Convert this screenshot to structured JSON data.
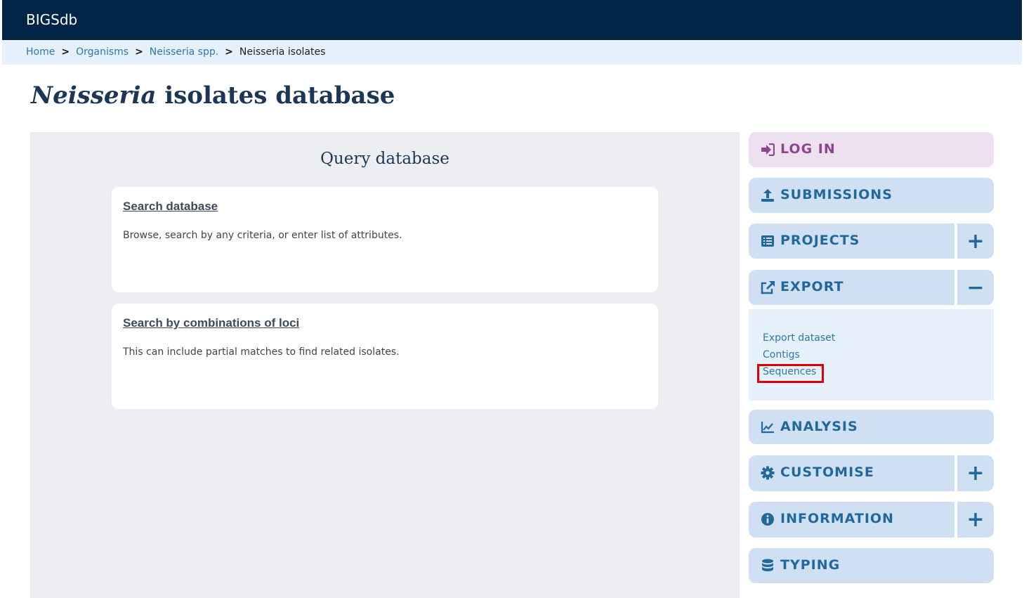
{
  "header": {
    "brand": "BIGSdb"
  },
  "breadcrumb": {
    "items": [
      "Home",
      "Organisms",
      "Neisseria spp."
    ],
    "separator": ">",
    "current": "Neisseria isolates"
  },
  "page_title": {
    "italic": "Neisseria",
    "rest": " isolates database"
  },
  "query": {
    "title": "Query database",
    "cards": [
      {
        "link": "Search database",
        "description": "Browse, search by any criteria, or enter list of attributes."
      },
      {
        "link": "Search by combinations of loci",
        "description": "This can include partial matches to find related isolates."
      }
    ]
  },
  "sidebar": {
    "login": "LOG IN",
    "submissions": "SUBMISSIONS",
    "projects": "PROJECTS",
    "export": "EXPORT",
    "analysis": "ANALYSIS",
    "customise": "CUSTOMISE",
    "information": "INFORMATION",
    "typing": "TYPING",
    "expand_symbol": "+",
    "collapse_symbol": "−",
    "export_items": [
      "Export dataset",
      "Contigs",
      "Sequences"
    ]
  },
  "colors": {
    "header_bg": "#022547",
    "breadcrumb_bg": "#e7f1fc",
    "menu_bg": "#cfe0f3",
    "login_bg": "#ede0ef",
    "highlight": "#e00000"
  },
  "icons": {
    "login": "sign-in-icon",
    "submissions": "upload-icon",
    "projects": "list-icon",
    "export": "external-link-icon",
    "analysis": "chart-line-icon",
    "customise": "gear-icon",
    "information": "info-circle-icon",
    "typing": "database-icon"
  }
}
